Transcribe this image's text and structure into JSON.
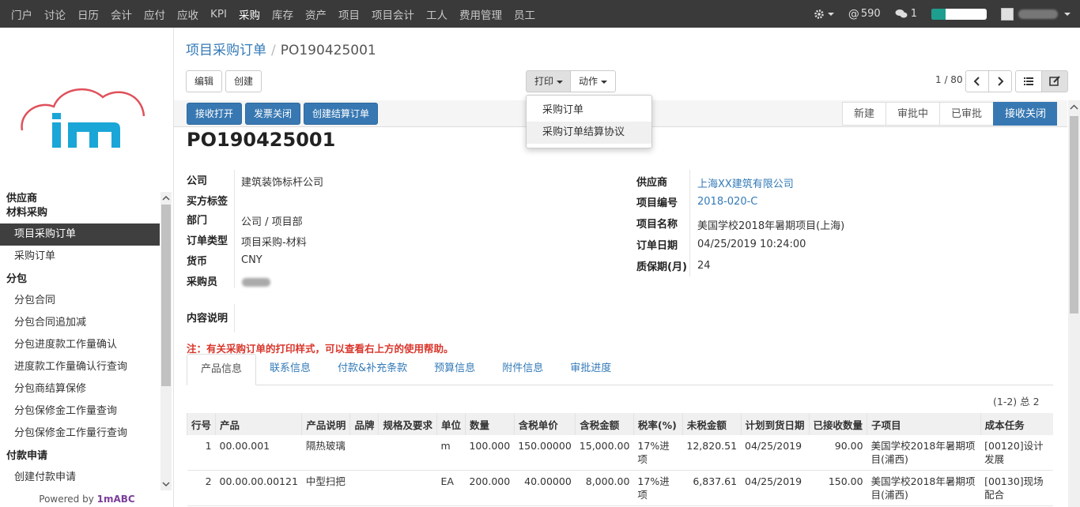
{
  "topnav": {
    "items": [
      "门户",
      "讨论",
      "日历",
      "会计",
      "应付",
      "应收",
      "KPI",
      "采购",
      "库存",
      "资产",
      "项目",
      "项目会计",
      "工人",
      "费用管理",
      "员工"
    ],
    "active_index": 7,
    "mentions": "590",
    "messages": "1",
    "progress_fraction": 0.26
  },
  "sidebar": {
    "powered_prefix": "Powered by ",
    "powered_brand": "1mABC",
    "entries": [
      {
        "type": "hdr",
        "label": "供应商"
      },
      {
        "type": "hdr",
        "label": "材料采购"
      },
      {
        "type": "itm",
        "label": "项目采购订单",
        "active": true
      },
      {
        "type": "itm",
        "label": "采购订单"
      },
      {
        "type": "hdr",
        "label": "分包"
      },
      {
        "type": "itm",
        "label": "分包合同"
      },
      {
        "type": "itm",
        "label": "分包合同追加减"
      },
      {
        "type": "itm",
        "label": "分包进度款工作量确认"
      },
      {
        "type": "itm",
        "label": "进度款工作量确认行查询"
      },
      {
        "type": "itm",
        "label": "分包商结算保修"
      },
      {
        "type": "itm",
        "label": "分包保修金工作量查询"
      },
      {
        "type": "itm",
        "label": "分包保修金工作量行查询"
      },
      {
        "type": "hdr",
        "label": "付款申请"
      },
      {
        "type": "itm",
        "label": "创建付款申请"
      }
    ]
  },
  "breadcrumb": {
    "parent": "项目采购订单",
    "current": "PO190425001"
  },
  "buttons": {
    "edit": "编辑",
    "create": "创建",
    "print": "打印",
    "action": "动作",
    "receive_open": "接收打开",
    "invoice_close": "发票关闭",
    "create_settlement": "创建结算订单"
  },
  "pager": {
    "text": "1 / 80"
  },
  "print_menu": [
    "采购订单",
    "采购订单结算协议"
  ],
  "status_steps": [
    "新建",
    "审批中",
    "已审批",
    "接收关闭"
  ],
  "status_current_index": 3,
  "record": {
    "title": "PO190425001",
    "left": [
      {
        "label": "公司",
        "value": "建筑装饰标杆公司"
      },
      {
        "label": "买方标签",
        "value": ""
      },
      {
        "label": "部门",
        "value": "公司 / 项目部"
      },
      {
        "label": "订单类型",
        "value": "项目采购-材料"
      },
      {
        "label": "货币",
        "value": "CNY"
      },
      {
        "label": "采购员",
        "value": ""
      }
    ],
    "right": [
      {
        "label": "供应商",
        "value": "上海XX建筑有限公司",
        "link": true
      },
      {
        "label": "项目编号",
        "value": "2018-020-C",
        "link": true
      },
      {
        "label": "项目名称",
        "value": "美国学校2018年暑期项目(上海)"
      },
      {
        "label": "订单日期",
        "value": "04/25/2019 10:24:00"
      },
      {
        "label": "质保期(月)",
        "value": "24"
      }
    ],
    "description_label": "内容说明"
  },
  "note": "注：有关采购订单的打印样式，可以查看右上方的使用帮助。",
  "tabs": [
    "产品信息",
    "联系信息",
    "付款&补充条款",
    "预算信息",
    "附件信息",
    "审批进度"
  ],
  "tabs_active_index": 0,
  "table": {
    "count": "(1-2) 总 2",
    "columns": [
      "行号",
      "产品",
      "产品说明",
      "品牌",
      "规格及要求",
      "单位",
      "数量",
      "含税单价",
      "含税金额",
      "税率(%)",
      "未税金额",
      "计划到货日期",
      "已接收数量",
      "子项目",
      "成本任务"
    ],
    "rows": [
      [
        "1",
        "00.00.001",
        "隔热玻璃",
        "",
        "",
        "m",
        "100.000",
        "150.00000",
        "15,000.00",
        "17%进项",
        "12,820.51",
        "04/25/2019",
        "90.00",
        "美国学校2018年暑期项目(浦西)",
        "[00120]设计发展"
      ],
      [
        "2",
        "00.00.00.00121",
        "中型扫把",
        "",
        "",
        "EA",
        "200.000",
        "40.00000",
        "8,000.00",
        "17%进项",
        "6,837.61",
        "04/25/2019",
        "150.00",
        "美国学校2018年暑期项目(浦西)",
        "[00130]现场配合"
      ]
    ]
  }
}
